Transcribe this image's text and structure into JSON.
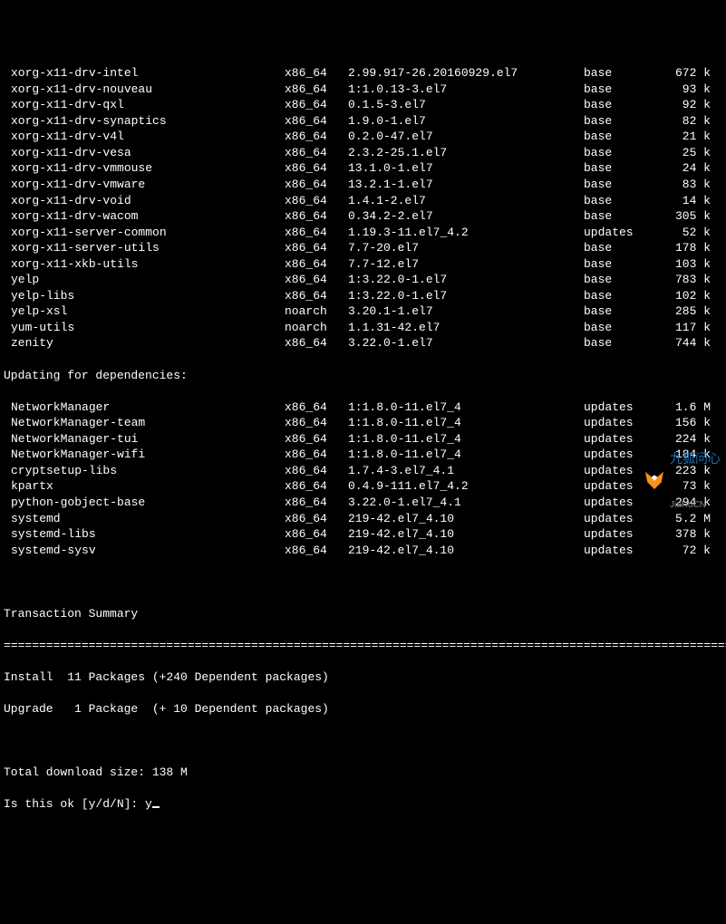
{
  "packages": [
    {
      "name": "xorg-x11-drv-intel",
      "arch": "x86_64",
      "version": "2.99.917-26.20160929.el7",
      "repo": "base",
      "size": "672 k"
    },
    {
      "name": "xorg-x11-drv-nouveau",
      "arch": "x86_64",
      "version": "1:1.0.13-3.el7",
      "repo": "base",
      "size": "93 k"
    },
    {
      "name": "xorg-x11-drv-qxl",
      "arch": "x86_64",
      "version": "0.1.5-3.el7",
      "repo": "base",
      "size": "92 k"
    },
    {
      "name": "xorg-x11-drv-synaptics",
      "arch": "x86_64",
      "version": "1.9.0-1.el7",
      "repo": "base",
      "size": "82 k"
    },
    {
      "name": "xorg-x11-drv-v4l",
      "arch": "x86_64",
      "version": "0.2.0-47.el7",
      "repo": "base",
      "size": "21 k"
    },
    {
      "name": "xorg-x11-drv-vesa",
      "arch": "x86_64",
      "version": "2.3.2-25.1.el7",
      "repo": "base",
      "size": "25 k"
    },
    {
      "name": "xorg-x11-drv-vmmouse",
      "arch": "x86_64",
      "version": "13.1.0-1.el7",
      "repo": "base",
      "size": "24 k"
    },
    {
      "name": "xorg-x11-drv-vmware",
      "arch": "x86_64",
      "version": "13.2.1-1.el7",
      "repo": "base",
      "size": "83 k"
    },
    {
      "name": "xorg-x11-drv-void",
      "arch": "x86_64",
      "version": "1.4.1-2.el7",
      "repo": "base",
      "size": "14 k"
    },
    {
      "name": "xorg-x11-drv-wacom",
      "arch": "x86_64",
      "version": "0.34.2-2.el7",
      "repo": "base",
      "size": "305 k"
    },
    {
      "name": "xorg-x11-server-common",
      "arch": "x86_64",
      "version": "1.19.3-11.el7_4.2",
      "repo": "updates",
      "size": "52 k"
    },
    {
      "name": "xorg-x11-server-utils",
      "arch": "x86_64",
      "version": "7.7-20.el7",
      "repo": "base",
      "size": "178 k"
    },
    {
      "name": "xorg-x11-xkb-utils",
      "arch": "x86_64",
      "version": "7.7-12.el7",
      "repo": "base",
      "size": "103 k"
    },
    {
      "name": "yelp",
      "arch": "x86_64",
      "version": "1:3.22.0-1.el7",
      "repo": "base",
      "size": "783 k"
    },
    {
      "name": "yelp-libs",
      "arch": "x86_64",
      "version": "1:3.22.0-1.el7",
      "repo": "base",
      "size": "102 k"
    },
    {
      "name": "yelp-xsl",
      "arch": "noarch",
      "version": "3.20.1-1.el7",
      "repo": "base",
      "size": "285 k"
    },
    {
      "name": "yum-utils",
      "arch": "noarch",
      "version": "1.1.31-42.el7",
      "repo": "base",
      "size": "117 k"
    },
    {
      "name": "zenity",
      "arch": "x86_64",
      "version": "3.22.0-1.el7",
      "repo": "base",
      "size": "744 k"
    }
  ],
  "deps_heading": "Updating for dependencies:",
  "deps": [
    {
      "name": "NetworkManager",
      "arch": "x86_64",
      "version": "1:1.8.0-11.el7_4",
      "repo": "updates",
      "size": "1.6 M"
    },
    {
      "name": "NetworkManager-team",
      "arch": "x86_64",
      "version": "1:1.8.0-11.el7_4",
      "repo": "updates",
      "size": "156 k"
    },
    {
      "name": "NetworkManager-tui",
      "arch": "x86_64",
      "version": "1:1.8.0-11.el7_4",
      "repo": "updates",
      "size": "224 k"
    },
    {
      "name": "NetworkManager-wifi",
      "arch": "x86_64",
      "version": "1:1.8.0-11.el7_4",
      "repo": "updates",
      "size": "184 k"
    },
    {
      "name": "cryptsetup-libs",
      "arch": "x86_64",
      "version": "1.7.4-3.el7_4.1",
      "repo": "updates",
      "size": "223 k"
    },
    {
      "name": "kpartx",
      "arch": "x86_64",
      "version": "0.4.9-111.el7_4.2",
      "repo": "updates",
      "size": "73 k"
    },
    {
      "name": "python-gobject-base",
      "arch": "x86_64",
      "version": "3.22.0-1.el7_4.1",
      "repo": "updates",
      "size": "294 k"
    },
    {
      "name": "systemd",
      "arch": "x86_64",
      "version": "219-42.el7_4.10",
      "repo": "updates",
      "size": "5.2 M"
    },
    {
      "name": "systemd-libs",
      "arch": "x86_64",
      "version": "219-42.el7_4.10",
      "repo": "updates",
      "size": "378 k"
    },
    {
      "name": "systemd-sysv",
      "arch": "x86_64",
      "version": "219-42.el7_4.10",
      "repo": "updates",
      "size": "72 k"
    }
  ],
  "summary_heading": "Transaction Summary",
  "divider": "================================================================================================================",
  "summary_lines": [
    "Install  11 Packages (+240 Dependent packages)",
    "Upgrade   1 Package  (+ 10 Dependent packages)"
  ],
  "total_line": "Total download size: 138 M",
  "prompt_label": "Is this ok [y/d/N]: ",
  "prompt_value": "y",
  "watermark": {
    "title": "九狐问心",
    "sub": "JiuHuCN"
  }
}
